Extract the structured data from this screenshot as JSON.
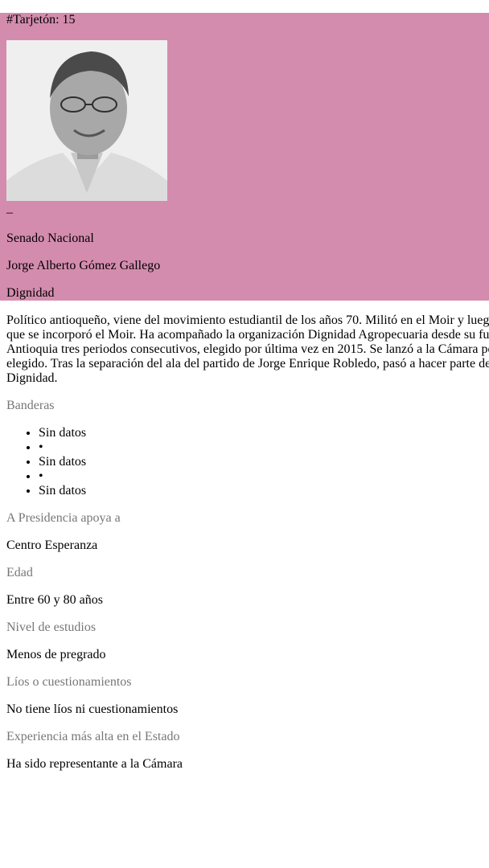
{
  "header": {
    "tarjeton_label": "#Tarjetón: 15",
    "dash": "–",
    "corporation": "Senado Nacional",
    "candidate_name": "Jorge Alberto Gómez Gallego",
    "party": "Dignidad",
    "background_color": "#d48cae"
  },
  "bio_lines": [
    "Político antioqueño, viene del movimiento estudiantil de los años 70. Militó en el Moir y lueg",
    "que se incorporó el Moir. Ha acompañado la organización Dignidad Agropecuaria desde su fu",
    "Antioquia tres periodos consecutivos, elegido por última vez en 2015. Se lanzó a la Cámara po",
    "elegido. Tras la separación del ala del partido de Jorge Enrique Robledo, pasó a hacer parte de",
    "Dignidad."
  ],
  "banderas": {
    "label": "Banderas",
    "items": [
      "Sin datos",
      "•",
      "Sin datos",
      "•",
      "Sin datos"
    ]
  },
  "presidencia": {
    "label": "A Presidencia apoya a",
    "value": "Centro Esperanza"
  },
  "edad": {
    "label": "Edad",
    "value": "Entre 60 y 80 años"
  },
  "estudios": {
    "label": "Nivel de estudios",
    "value": "Menos de pregrado"
  },
  "lios": {
    "label": "Líos o cuestionamientos",
    "value": "No tiene líos ni cuestionamientos"
  },
  "experiencia": {
    "label": "Experiencia más alta en el Estado",
    "value": "Ha sido representante a la Cámara"
  },
  "colors": {
    "muted_label": "#777777"
  }
}
